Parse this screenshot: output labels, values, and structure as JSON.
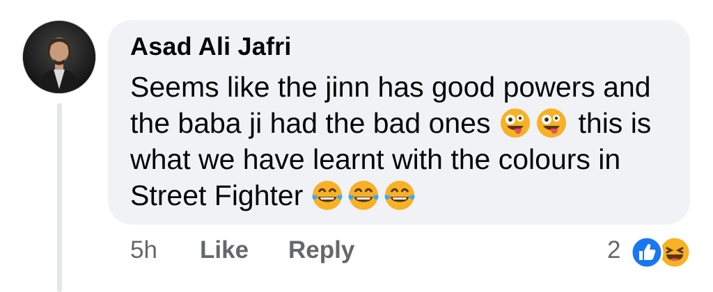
{
  "comment": {
    "author": "Asad Ali Jafri",
    "lines": [
      "Seems like the jinn has good powers and",
      "the baba ji had the bad ones",
      "this is",
      "what we have learnt with the colours in",
      "Street Fighter"
    ],
    "emojis": {
      "line2": [
        "zany-face-emoji",
        "zany-face-emoji"
      ],
      "line4": [
        "tears-of-joy-emoji",
        "tears-of-joy-emoji",
        "tears-of-joy-emoji"
      ]
    }
  },
  "actions": {
    "timestamp": "5h",
    "like_label": "Like",
    "reply_label": "Reply"
  },
  "reactions": {
    "count": "2",
    "types": [
      "like-reaction-icon",
      "haha-reaction-icon"
    ]
  },
  "colors": {
    "bubble": "#f0f2f5",
    "text": "#050505",
    "meta": "#65676b",
    "like_blue": "#1877f2",
    "emoji_yellow": "#f7b125"
  }
}
